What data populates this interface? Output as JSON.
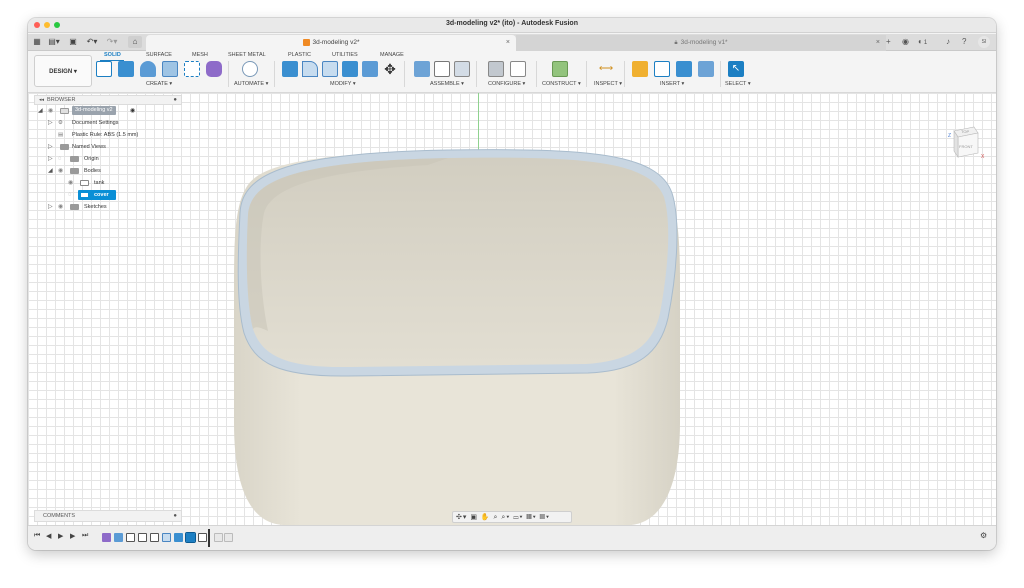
{
  "window": {
    "title": "3d-modeling v2* (ito) - Autodesk Fusion"
  },
  "tabs": {
    "active_label": "3d-modeling v2*",
    "inactive_label": "3d-modeling v1*",
    "close_glyph": "×"
  },
  "topbar_right": {
    "job_count": "1",
    "user_initials": "SI"
  },
  "workspace": {
    "label": "DESIGN ▾"
  },
  "ribbon_tabs": [
    "SOLID",
    "SURFACE",
    "MESH",
    "SHEET METAL",
    "PLASTIC",
    "UTILITIES",
    "MANAGE"
  ],
  "ribbon_groups": {
    "create": "CREATE ▾",
    "automate": "AUTOMATE ▾",
    "modify": "MODIFY ▾",
    "assemble": "ASSEMBLE ▾",
    "configure": "CONFIGURE ▾",
    "construct": "CONSTRUCT ▾",
    "inspect": "INSPECT ▾",
    "insert": "INSERT ▾",
    "select": "SELECT ▾"
  },
  "browser": {
    "title": "BROWSER",
    "root": "3d-modeling v2",
    "document_settings": "Document Settings",
    "plastic_rule": "Plastic Rule: ABS (1.5 mm)",
    "named_views": "Named Views",
    "origin": "Origin",
    "bodies": "Bodies",
    "body_tank": "tank",
    "body_cover": "cover",
    "sketches": "Sketches"
  },
  "comments": {
    "title": "COMMENTS"
  },
  "viewcube": {
    "top_label": "TOP",
    "front_label": "FRONT",
    "z_axis": "Z",
    "x_axis": "X"
  },
  "navbar": {
    "tools": "✣▾ ▣ ✋ ⌕ ⌕▾ ▭▾ ▦▾ ▤▾"
  },
  "colors": {
    "accent": "#1c7fc3",
    "model_body": "#e3dfd3",
    "model_rim": "#c9d6e2",
    "grid": "#e4e4e4",
    "selection": "#0a8fd6"
  },
  "icons": {
    "home": "home-icon",
    "undo": "undo-icon",
    "redo": "redo-icon",
    "save": "save-icon",
    "grid_menu": "app-grid-icon",
    "settings": "gear-icon"
  }
}
